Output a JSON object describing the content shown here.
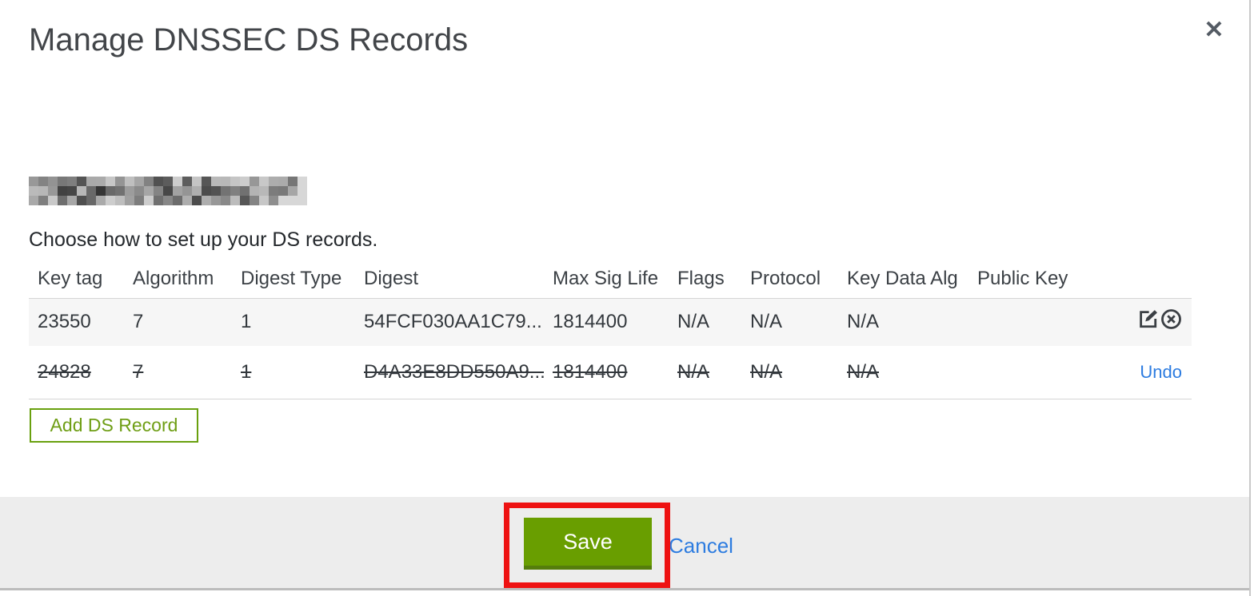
{
  "dialog": {
    "title": "Manage DNSSEC DS Records",
    "subtitle": "Choose how to set up your DS records.",
    "domain_redacted": true
  },
  "icons": {
    "close": "✕"
  },
  "table": {
    "columns": [
      "Key tag",
      "Algorithm",
      "Digest Type",
      "Digest",
      "Max Sig Life",
      "Flags",
      "Protocol",
      "Key Data Alg",
      "Public Key"
    ],
    "rows": [
      {
        "key_tag": "23550",
        "algorithm": "7",
        "digest_type": "1",
        "digest": "54FCF030AA1C79...",
        "max_sig_life": "1814400",
        "flags": "N/A",
        "protocol": "N/A",
        "key_data_alg": "N/A",
        "public_key": "",
        "state": "active"
      },
      {
        "key_tag": "24828",
        "algorithm": "7",
        "digest_type": "1",
        "digest": "D4A33E8DD550A9...",
        "max_sig_life": "1814400",
        "flags": "N/A",
        "protocol": "N/A",
        "key_data_alg": "N/A",
        "public_key": "",
        "state": "marked-for-deletion",
        "undo_label": "Undo"
      }
    ]
  },
  "buttons": {
    "add_record": "Add DS Record",
    "save": "Save",
    "cancel": "Cancel"
  },
  "colors": {
    "accent_green": "#699e00",
    "outline_green": "#69a00e",
    "link_blue": "#2d7ce0",
    "annotation_red": "#ee1212",
    "footer_gray": "#ededed",
    "row_gray": "#f6f6f6"
  }
}
